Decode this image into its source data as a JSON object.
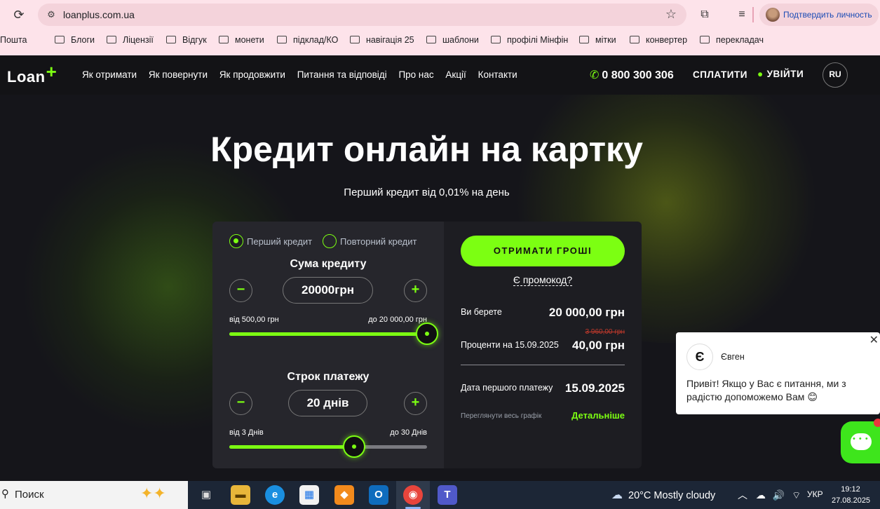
{
  "browser": {
    "url": "loanplus.com.ua",
    "profile_label": "Подтвердить личность",
    "bookmarks": [
      "Пошта",
      "Блоги",
      "Ліцензії",
      "Відгук",
      "монети",
      "підклад/КО",
      "навігація 25",
      "шаблони",
      "профілі Мінфін",
      "мітки",
      "конвертер",
      "перекладач"
    ]
  },
  "site": {
    "logo": "Loan",
    "nav": [
      "Як отримати",
      "Як повернути",
      "Як продовжити",
      "Питання та відповіді",
      "Про нас",
      "Акції",
      "Контакти"
    ],
    "phone": "0 800 300 306",
    "pay_label": "СПЛАТИТИ",
    "login_label": "УВІЙТИ",
    "lang_label": "RU",
    "hero_title": "Кредит онлайн на картку",
    "hero_subtitle": "Перший кредит від 0,01% на день",
    "accent_color": "#7cff12"
  },
  "calculator": {
    "radio_first": "Перший кредит",
    "radio_repeat": "Повторний кредит",
    "selected": "first",
    "amount_label": "Сума кредиту",
    "amount_value": "20000грн",
    "amount_min": "від 500,00 грн",
    "amount_max": "до 20 000,00 грн",
    "amount_fraction": 1.0,
    "term_label": "Строк платежу",
    "term_value": "20 днів",
    "term_min": "від 3 Днів",
    "term_max": "до 30 Днів",
    "term_fraction": 0.63,
    "get_money_label": "ОТРИМАТИ ГРОШІ",
    "promo_label": "Є промокод?",
    "take_label": "Ви берете",
    "take_value": "20 000,00 грн",
    "interest_old": "3 960,00 грн",
    "interest_label": "Проценти на 15.09.2025",
    "interest_value": "40,00 грн",
    "first_payment_label": "Дата першого платежу",
    "first_payment_value": "15.09.2025",
    "schedule_label": "Переглянути весь графік",
    "details_label": "Детальніше"
  },
  "chat": {
    "avatar_letter": "Є",
    "agent_name": "Євген",
    "message": "Привіт! Якщо у Вас є питання, ми з радістю допоможемо Вам 😊"
  },
  "taskbar": {
    "search_label": "Поиск",
    "weather": "20°C  Mostly cloudy",
    "language": "УКР",
    "time": "19:12",
    "date": "27.08.2025"
  }
}
